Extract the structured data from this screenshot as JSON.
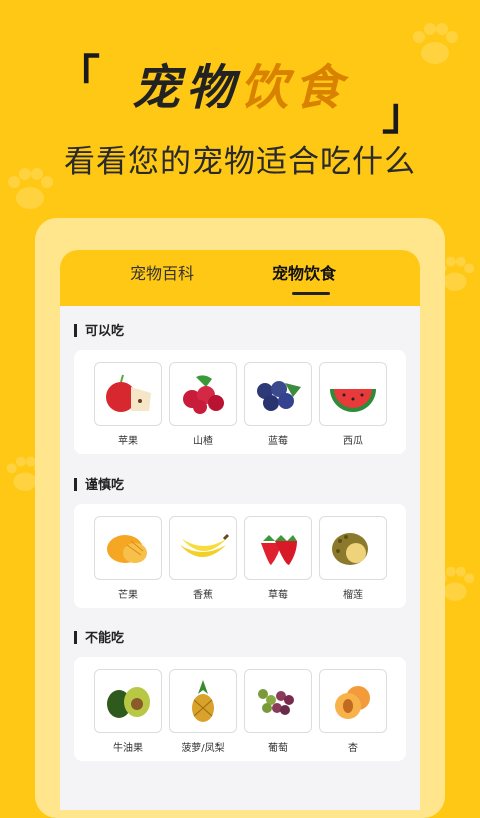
{
  "header": {
    "bracket_open": "「",
    "bracket_close": "」",
    "title_part1": "宠物",
    "title_part2": "饮食",
    "subtitle": "看看您的宠物适合吃什么"
  },
  "tabs": [
    {
      "label": "宠物百科",
      "active": false
    },
    {
      "label": "宠物饮食",
      "active": true
    }
  ],
  "sections": [
    {
      "title": "可以吃",
      "items": [
        {
          "label": "苹果",
          "icon": "apple-icon"
        },
        {
          "label": "山楂",
          "icon": "hawthorn-icon"
        },
        {
          "label": "蓝莓",
          "icon": "blueberry-icon"
        },
        {
          "label": "西瓜",
          "icon": "watermelon-icon"
        }
      ]
    },
    {
      "title": "谨慎吃",
      "items": [
        {
          "label": "芒果",
          "icon": "mango-icon"
        },
        {
          "label": "香蕉",
          "icon": "banana-icon"
        },
        {
          "label": "草莓",
          "icon": "strawberry-icon"
        },
        {
          "label": "榴莲",
          "icon": "durian-icon"
        }
      ]
    },
    {
      "title": "不能吃",
      "items": [
        {
          "label": "牛油果",
          "icon": "avocado-icon"
        },
        {
          "label": "菠萝/凤梨",
          "icon": "pineapple-icon"
        },
        {
          "label": "葡萄",
          "icon": "grape-icon"
        },
        {
          "label": "杏",
          "icon": "apricot-icon"
        }
      ]
    }
  ],
  "colors": {
    "background": "#FFC815",
    "accent": "#D98200",
    "card_border": "#FFE68C"
  }
}
